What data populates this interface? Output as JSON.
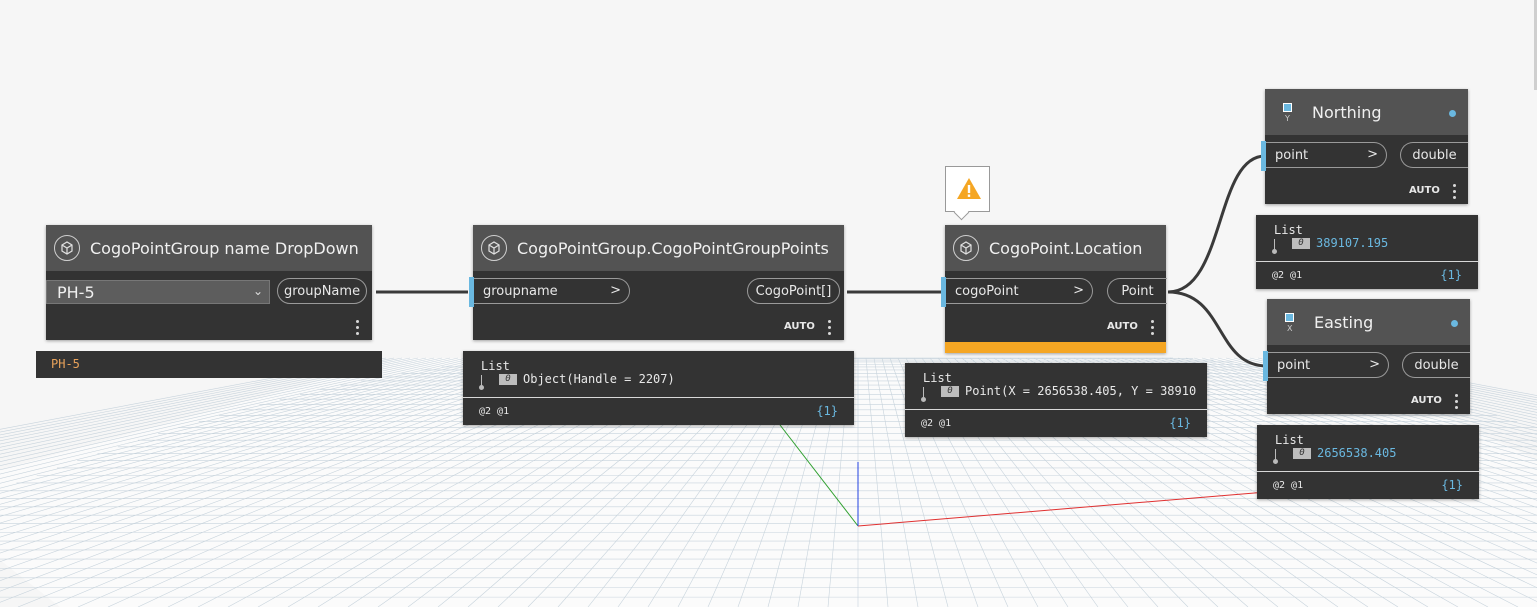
{
  "colors": {
    "canvas": "#f6f6f6",
    "node_body": "#333333",
    "node_header": "#535353",
    "input_marker": "#6ab8e0",
    "warning_bar": "#f5a623",
    "wire": "#3a3a3a",
    "dropdown_value": "#e8a25a",
    "number_value": "#6ab8e0"
  },
  "nodes": {
    "dropdown": {
      "title": "CogoPointGroup name DropDown",
      "icon": "cube-icon",
      "selected": "PH-5",
      "output": "groupName",
      "preview_value": "PH-5"
    },
    "group_points": {
      "title": "CogoPointGroup.CogoPointGroupPoints",
      "icon": "cube-icon",
      "input": "groupname",
      "output": "CogoPoint[]",
      "lacing": "AUTO",
      "preview": {
        "list_label": "List",
        "index": "0",
        "value": "Object(Handle = 2207)",
        "levels": "@2 @1",
        "count": "{1}"
      }
    },
    "location": {
      "title": "CogoPoint.Location",
      "icon": "cube-icon",
      "input": "cogoPoint",
      "output": "Point",
      "lacing": "AUTO",
      "warning_icon": "warning-icon",
      "preview": {
        "list_label": "List",
        "index": "0",
        "value": "Point(X = 2656538.405, Y = 38910",
        "levels": "@2 @1",
        "count": "{1}"
      }
    },
    "northing": {
      "title": "Northing",
      "icon": "point-y-icon",
      "icon_letter": "Y",
      "input": "point",
      "output": "double",
      "lacing": "AUTO",
      "preview": {
        "list_label": "List",
        "index": "0",
        "value": "389107.195",
        "levels": "@2 @1",
        "count": "{1}"
      }
    },
    "easting": {
      "title": "Easting",
      "icon": "point-x-icon",
      "icon_letter": "X",
      "input": "point",
      "output": "double",
      "lacing": "AUTO",
      "preview": {
        "list_label": "List",
        "index": "0",
        "value": "2656538.405",
        "levels": "@2 @1",
        "count": "{1}"
      }
    }
  }
}
